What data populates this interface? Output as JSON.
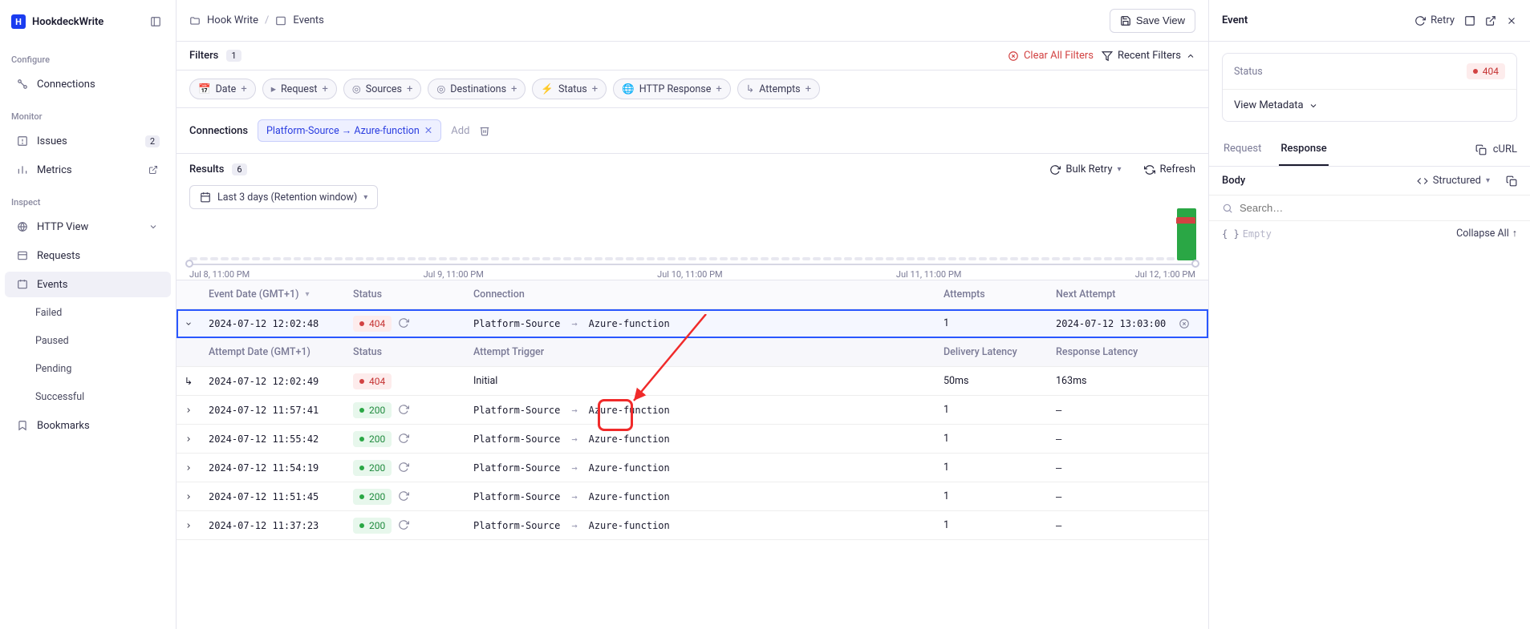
{
  "workspace": "HookdeckWrite",
  "breadcrumb": {
    "folder": "Hook Write",
    "page": "Events"
  },
  "save_view": "Save View",
  "sidebar": {
    "sections": {
      "configure": "Configure",
      "monitor": "Monitor",
      "inspect": "Inspect"
    },
    "connections": "Connections",
    "issues": {
      "label": "Issues",
      "count": "2"
    },
    "metrics": "Metrics",
    "http_view": "HTTP View",
    "requests": "Requests",
    "events": "Events",
    "events_sub": [
      "Failed",
      "Paused",
      "Pending",
      "Successful"
    ],
    "bookmarks": "Bookmarks"
  },
  "filters": {
    "label": "Filters",
    "count": "1",
    "clear": "Clear All Filters",
    "recent": "Recent Filters",
    "chips": [
      "Date",
      "Request",
      "Sources",
      "Destinations",
      "Status",
      "HTTP Response",
      "Attempts"
    ]
  },
  "connections": {
    "label": "Connections",
    "chip": "Platform-Source → Azure-function",
    "add": "Add"
  },
  "results": {
    "label": "Results",
    "count": "6",
    "bulk_retry": "Bulk Retry",
    "refresh": "Refresh",
    "date_range": "Last 3 days (Retention window)"
  },
  "histogram_labels": [
    "Jul 8, 11:00 PM",
    "Jul 9, 11:00 PM",
    "Jul 10, 11:00 PM",
    "Jul 11, 11:00 PM",
    "Jul 12, 1:00 PM"
  ],
  "table": {
    "headers": {
      "date": "Event Date (GMT+1)",
      "status": "Status",
      "connection": "Connection",
      "attempts": "Attempts",
      "next": "Next Attempt"
    },
    "sub_headers": {
      "date": "Attempt Date (GMT+1)",
      "status": "Status",
      "trigger": "Attempt Trigger",
      "del": "Delivery Latency",
      "resp": "Response Latency"
    },
    "rows": [
      {
        "date": "2024-07-12 12:02:48",
        "status": "404",
        "conn_src": "Platform-Source",
        "conn_dst": "Azure-function",
        "attempts": "1",
        "next": "2024-07-12 13:03:00",
        "expanded": true,
        "err": true
      },
      {
        "date": "2024-07-12 11:57:41",
        "status": "200",
        "conn_src": "Platform-Source",
        "conn_dst": "Azure-function",
        "attempts": "1",
        "next": "–"
      },
      {
        "date": "2024-07-12 11:55:42",
        "status": "200",
        "conn_src": "Platform-Source",
        "conn_dst": "Azure-function",
        "attempts": "1",
        "next": "–"
      },
      {
        "date": "2024-07-12 11:54:19",
        "status": "200",
        "conn_src": "Platform-Source",
        "conn_dst": "Azure-function",
        "attempts": "1",
        "next": "–"
      },
      {
        "date": "2024-07-12 11:51:45",
        "status": "200",
        "conn_src": "Platform-Source",
        "conn_dst": "Azure-function",
        "attempts": "1",
        "next": "–"
      },
      {
        "date": "2024-07-12 11:37:23",
        "status": "200",
        "conn_src": "Platform-Source",
        "conn_dst": "Azure-function",
        "attempts": "1",
        "next": "–"
      }
    ],
    "attempt_row": {
      "date": "2024-07-12 12:02:49",
      "status": "404",
      "trigger": "Initial",
      "del": "50ms",
      "resp": "163ms"
    }
  },
  "rpanel": {
    "title": "Event",
    "retry": "Retry",
    "status_label": "Status",
    "status_value": "404",
    "view_metadata": "View Metadata",
    "tabs": {
      "request": "Request",
      "response": "Response",
      "curl": "cURL"
    },
    "body": "Body",
    "structured": "Structured",
    "search_placeholder": "Search…",
    "empty": "Empty",
    "collapse_all": "Collapse All"
  }
}
